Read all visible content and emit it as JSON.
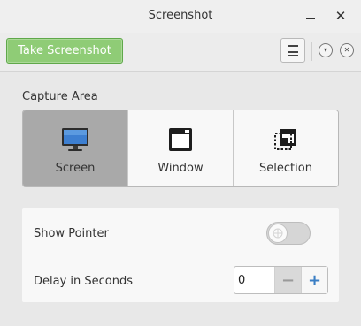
{
  "window": {
    "title": "Screenshot"
  },
  "headerbar": {
    "take_screenshot_label": "Take Screenshot"
  },
  "capture_area": {
    "label": "Capture Area",
    "options": [
      {
        "label": "Screen",
        "icon": "monitor-icon",
        "selected": true
      },
      {
        "label": "Window",
        "icon": "window-icon",
        "selected": false
      },
      {
        "label": "Selection",
        "icon": "selection-icon",
        "selected": false
      }
    ]
  },
  "options": {
    "show_pointer_label": "Show Pointer",
    "show_pointer_enabled": false,
    "delay_label": "Delay in Seconds",
    "delay_value": "0"
  },
  "colors": {
    "accent_green": "#8fcc76",
    "selected_tab": "#a9a9a9",
    "plus_blue": "#3a7ec4"
  }
}
